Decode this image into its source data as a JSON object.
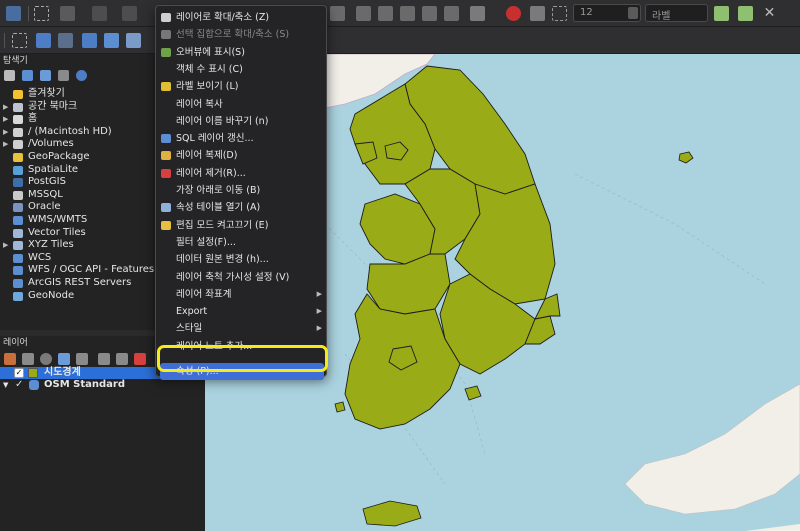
{
  "toolbar": {
    "font_size_value": "12",
    "label_combo_value": "라벨"
  },
  "browser": {
    "title": "탐색기",
    "items": [
      {
        "label": "즐겨찾기",
        "icon": "star-icon",
        "color": "#f2c230",
        "expand": false
      },
      {
        "label": "공간 북마크",
        "icon": "bookmark-icon",
        "color": "#bfc5cc",
        "expand": true
      },
      {
        "label": "홈",
        "icon": "home-folder-icon",
        "color": "#d8d8d8",
        "expand": true
      },
      {
        "label": "/ (Macintosh HD)",
        "icon": "folder-icon",
        "color": "#cfcfcf",
        "expand": true
      },
      {
        "label": "/Volumes",
        "icon": "folder-icon",
        "color": "#cfcfcf",
        "expand": true
      },
      {
        "label": "GeoPackage",
        "icon": "geopackage-icon",
        "color": "#e6c13a",
        "expand": false
      },
      {
        "label": "SpatiaLite",
        "icon": "spatialite-icon",
        "color": "#5aa0d8",
        "expand": false
      },
      {
        "label": "PostGIS",
        "icon": "postgis-icon",
        "color": "#3d6ea8",
        "expand": false
      },
      {
        "label": "MSSQL",
        "icon": "mssql-icon",
        "color": "#c9c9c9",
        "expand": false
      },
      {
        "label": "Oracle",
        "icon": "oracle-icon",
        "color": "#7a93c0",
        "expand": false
      },
      {
        "label": "WMS/WMTS",
        "icon": "wms-globe-icon",
        "color": "#5b8fd1",
        "expand": false
      },
      {
        "label": "Vector Tiles",
        "icon": "vector-tiles-icon",
        "color": "#9fb7d8",
        "expand": false
      },
      {
        "label": "XYZ Tiles",
        "icon": "xyz-tiles-icon",
        "color": "#9fb7d8",
        "expand": true
      },
      {
        "label": "WCS",
        "icon": "wcs-globe-icon",
        "color": "#5b8fd1",
        "expand": false
      },
      {
        "label": "WFS / OGC API - Features",
        "icon": "wfs-globe-icon",
        "color": "#5b8fd1",
        "expand": false
      },
      {
        "label": "ArcGIS REST Servers",
        "icon": "arcgis-globe-icon",
        "color": "#5b8fd1",
        "expand": false
      },
      {
        "label": "GeoNode",
        "icon": "geonode-icon",
        "color": "#6fa8dc",
        "expand": false
      }
    ]
  },
  "layers": {
    "title": "레이어",
    "items": [
      {
        "label": "시도경계",
        "checked": "✓",
        "swatch": "#9aab18"
      },
      {
        "label": "OSM Standard",
        "checked": "✓",
        "swatch": "#5b8fd1"
      }
    ]
  },
  "context_menu": {
    "items": [
      {
        "label": "레이어로 확대/축소 (Z)",
        "icon": "zoom-to-layer-icon",
        "color": "#cfcfcf",
        "disabled": false,
        "submenu": false
      },
      {
        "label": "선택 집합으로 확대/축소 (S)",
        "icon": "zoom-to-selection-icon",
        "color": "#777",
        "disabled": true,
        "submenu": false
      },
      {
        "label": "오버뷰에 표시(S)",
        "icon": "overview-icon",
        "color": "#6ea34a",
        "disabled": false,
        "submenu": false
      },
      {
        "label": "객체 수 표시 (C)",
        "icon": "",
        "color": "",
        "disabled": false,
        "submenu": false
      },
      {
        "label": "라벨 보이기 (L)",
        "icon": "label-icon",
        "color": "#e0c030",
        "disabled": false,
        "submenu": false
      },
      {
        "label": "레이어 복사",
        "icon": "",
        "color": "",
        "disabled": false,
        "submenu": false
      },
      {
        "label": "레이어 이름 바꾸기 (n)",
        "icon": "",
        "color": "",
        "disabled": false,
        "submenu": false
      },
      {
        "label": "SQL 레이어 갱신...",
        "icon": "sql-layer-icon",
        "color": "#5b8fd1",
        "disabled": false,
        "submenu": false
      },
      {
        "label": "레이어 복제(D)",
        "icon": "duplicate-layer-icon",
        "color": "#e0b040",
        "disabled": false,
        "submenu": false
      },
      {
        "label": "레이어 제거(R)...",
        "icon": "remove-layer-icon",
        "color": "#d84040",
        "disabled": false,
        "submenu": false
      },
      {
        "label": "가장 아래로 이동 (B)",
        "icon": "",
        "color": "",
        "disabled": false,
        "submenu": false
      },
      {
        "label": "속성 테이블 열기 (A)",
        "icon": "attribute-table-icon",
        "color": "#8fb0d8",
        "disabled": false,
        "submenu": false
      },
      {
        "label": "편집 모드 켜고끄기 (E)",
        "icon": "pencil-icon",
        "color": "#e8c040",
        "disabled": false,
        "submenu": false
      },
      {
        "label": "필터 설정(F)...",
        "icon": "",
        "color": "",
        "disabled": false,
        "submenu": false
      },
      {
        "label": "데이터 원본 변경 (h)...",
        "icon": "",
        "color": "",
        "disabled": false,
        "submenu": false
      },
      {
        "label": "레이어 축척 가시성 설정 (V)",
        "icon": "",
        "color": "",
        "disabled": false,
        "submenu": false
      },
      {
        "label": "레이어 좌표계",
        "icon": "",
        "color": "",
        "disabled": false,
        "submenu": true
      },
      {
        "label": "Export",
        "icon": "",
        "color": "",
        "disabled": false,
        "submenu": true
      },
      {
        "label": "스타일",
        "icon": "",
        "color": "",
        "disabled": false,
        "submenu": true
      },
      {
        "label": "레이어 노트 추가...",
        "icon": "",
        "color": "",
        "disabled": false,
        "submenu": false
      },
      {
        "label": "속성 (P)...",
        "icon": "",
        "color": "",
        "disabled": false,
        "submenu": false,
        "highlighted": true
      }
    ]
  },
  "colors": {
    "land": "#9aab18",
    "sea": "#aad3df",
    "highlight_ring": "#f5ea1a",
    "menu_highlight": "#3e6ed6"
  }
}
